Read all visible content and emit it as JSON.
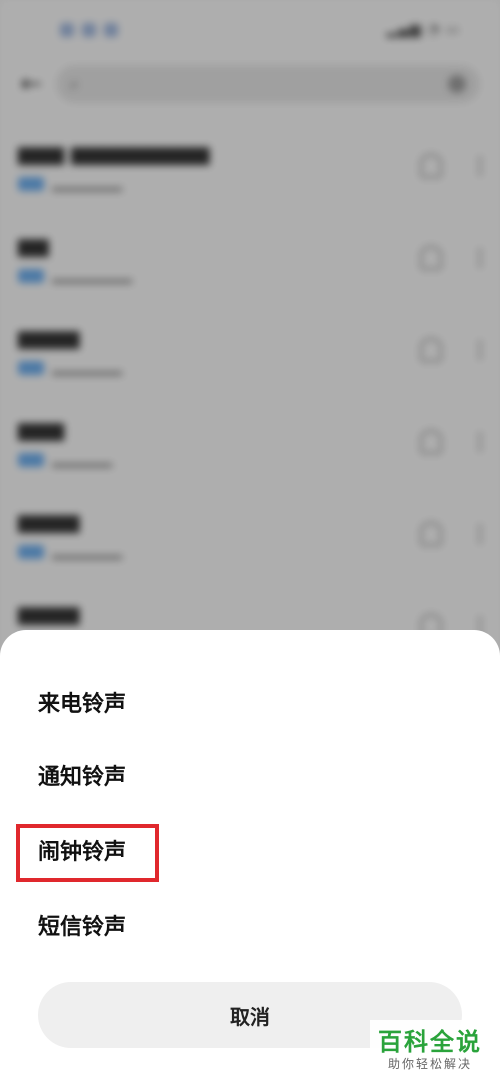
{
  "sheet": {
    "items": [
      {
        "label": "来电铃声"
      },
      {
        "label": "通知铃声"
      },
      {
        "label": "闹钟铃声"
      },
      {
        "label": "短信铃声"
      }
    ],
    "cancel_label": "取消",
    "highlight_color": "#e0282d"
  },
  "watermark": {
    "main": "百科全说",
    "sub": "助你轻松解决",
    "color": "#2aa33b"
  }
}
